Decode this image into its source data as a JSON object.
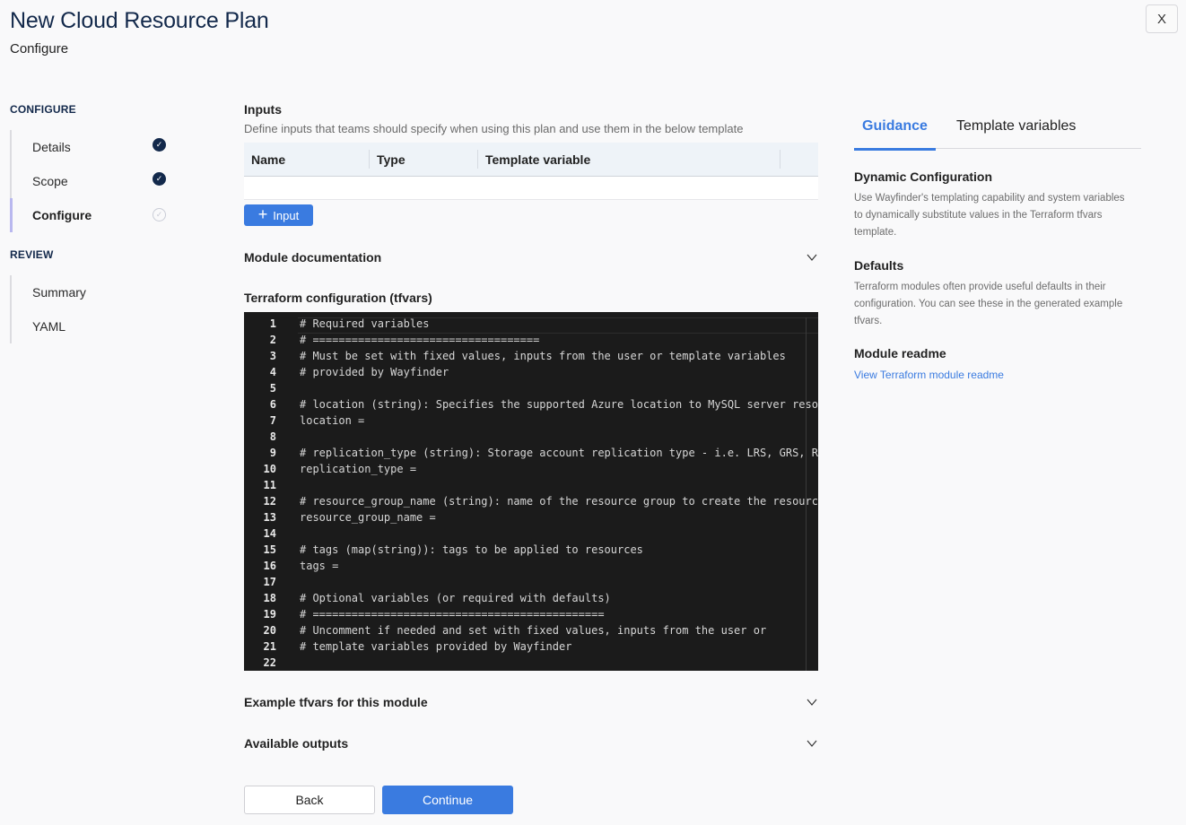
{
  "header": {
    "title": "New Cloud Resource Plan",
    "subtitle": "Configure",
    "close_label": "X"
  },
  "sidebar": {
    "sections": [
      {
        "heading": "CONFIGURE",
        "items": [
          {
            "label": "Details",
            "status": "complete"
          },
          {
            "label": "Scope",
            "status": "complete"
          },
          {
            "label": "Configure",
            "status": "current"
          }
        ]
      },
      {
        "heading": "REVIEW",
        "items": [
          {
            "label": "Summary",
            "status": "none"
          },
          {
            "label": "YAML",
            "status": "none"
          }
        ]
      }
    ]
  },
  "main": {
    "inputs": {
      "title": "Inputs",
      "description": "Define inputs that teams should specify when using this plan and use them in the below template",
      "columns": [
        "Name",
        "Type",
        "Template variable"
      ],
      "rows": [],
      "add_button_label": "Input"
    },
    "module_documentation_label": "Module documentation",
    "terraform_label": "Terraform configuration (tfvars)",
    "code_lines": [
      "# Required variables",
      "# ===================================",
      "# Must be set with fixed values, inputs from the user or template variables",
      "# provided by Wayfinder",
      "",
      "# location (string): Specifies the supported Azure location to MySQL server resource",
      "location =",
      "",
      "# replication_type (string): Storage account replication type - i.e. LRS, GRS, RAGRS",
      "replication_type =",
      "",
      "# resource_group_name (string): name of the resource group to create the resource",
      "resource_group_name =",
      "",
      "# tags (map(string)): tags to be applied to resources",
      "tags =",
      "",
      "# Optional variables (or required with defaults)",
      "# =============================================",
      "# Uncomment if needed and set with fixed values, inputs from the user or",
      "# template variables provided by Wayfinder",
      ""
    ],
    "example_tfvars_label": "Example tfvars for this module",
    "available_outputs_label": "Available outputs",
    "back_label": "Back",
    "continue_label": "Continue"
  },
  "guidance": {
    "tabs": [
      {
        "label": "Guidance",
        "active": true
      },
      {
        "label": "Template variables",
        "active": false
      }
    ],
    "sections": [
      {
        "title": "Dynamic Configuration",
        "text": "Use Wayfinder's templating capability and system variables to dynamically substitute values in the Terraform tfvars template."
      },
      {
        "title": "Defaults",
        "text": "Terraform modules often provide useful defaults in their configuration. You can see these in the generated example tfvars."
      }
    ],
    "readme_title": "Module readme",
    "readme_link": "View Terraform module readme"
  },
  "colors": {
    "brand_navy": "#13294b",
    "accent_blue": "#3a7be0",
    "editor_bg": "#1b1b1b"
  }
}
